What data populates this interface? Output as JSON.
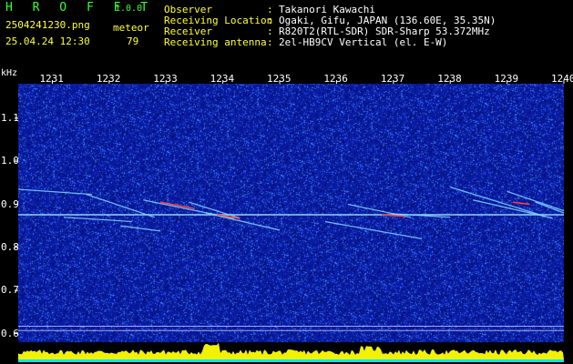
{
  "app": {
    "brand": "H R O F F T",
    "version": "1.0.0",
    "filename": "2504241230.png",
    "datetime": "25.04.24 12:30",
    "count_label": "meteor",
    "count_value": "79"
  },
  "header": [
    {
      "label": "Observer",
      "value": "Takanori Kawachi"
    },
    {
      "label": "Receiving Location",
      "value": "Ogaki, Gifu, JAPAN (136.60E, 35.35N)"
    },
    {
      "label": "Receiver",
      "value": "R820T2(RTL-SDR) SDR-Sharp 53.372MHz"
    },
    {
      "label": "Receiving antenna",
      "value": "2el-HB9CV Vertical (el. E-W)"
    }
  ],
  "chart_data": {
    "type": "heatmap",
    "yunit": "kHz",
    "x_ticks": [
      "1231",
      "1232",
      "1233",
      "1234",
      "1235",
      "1236",
      "1237",
      "1238",
      "1239",
      "1240"
    ],
    "y_ticks": [
      "1.1",
      "1.0",
      "0.9",
      "0.8",
      "0.7",
      "0.6"
    ],
    "ylim": [
      0.58,
      1.18
    ],
    "xlim_minutes": [
      1230.4,
      1240.0
    ],
    "carrier_khz": 0.875,
    "reference_lines_khz": [
      0.617,
      0.607
    ],
    "trails": [
      {
        "t0": 1230.4,
        "f0": 0.935,
        "t1": 1231.7,
        "f1": 0.923
      },
      {
        "t0": 1231.6,
        "f0": 0.923,
        "t1": 1232.8,
        "f1": 0.87
      },
      {
        "t0": 1231.2,
        "f0": 0.87,
        "t1": 1232.4,
        "f1": 0.86
      },
      {
        "t0": 1232.2,
        "f0": 0.85,
        "t1": 1232.9,
        "f1": 0.838
      },
      {
        "t0": 1232.6,
        "f0": 0.91,
        "t1": 1234.2,
        "f1": 0.867
      },
      {
        "t0": 1233.4,
        "f0": 0.905,
        "t1": 1234.3,
        "f1": 0.868
      },
      {
        "t0": 1233.7,
        "f0": 0.88,
        "t1": 1235.0,
        "f1": 0.84
      },
      {
        "t0": 1235.8,
        "f0": 0.86,
        "t1": 1237.5,
        "f1": 0.82
      },
      {
        "t0": 1236.2,
        "f0": 0.9,
        "t1": 1237.3,
        "f1": 0.87
      },
      {
        "t0": 1237.0,
        "f0": 0.878,
        "t1": 1238.0,
        "f1": 0.87
      },
      {
        "t0": 1238.0,
        "f0": 0.94,
        "t1": 1239.6,
        "f1": 0.875
      },
      {
        "t0": 1238.4,
        "f0": 0.91,
        "t1": 1239.8,
        "f1": 0.868
      },
      {
        "t0": 1239.0,
        "f0": 0.93,
        "t1": 1240.0,
        "f1": 0.885
      },
      {
        "t0": 1239.5,
        "f0": 0.905,
        "t1": 1240.0,
        "f1": 0.88
      }
    ],
    "background_color": "#0a1a8c",
    "noise_color": "#3a7cff",
    "carrier_color": "#9fe8ff",
    "strong_color": "#ff4040",
    "power_color": "#ffff00",
    "baseline_color": "#00e5ff"
  }
}
